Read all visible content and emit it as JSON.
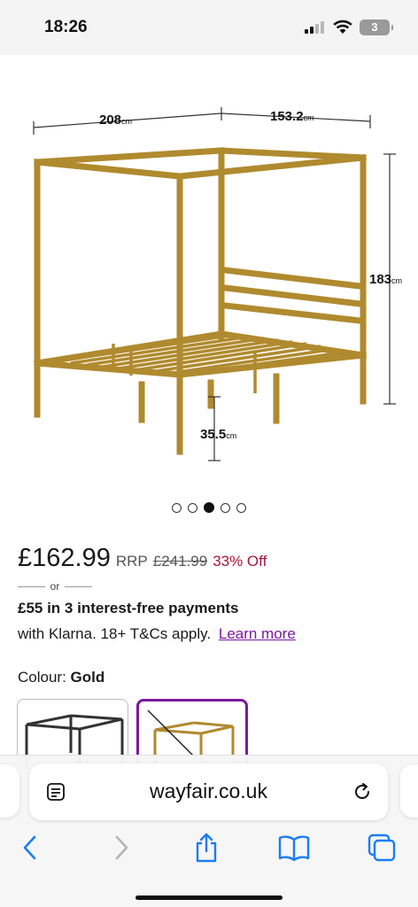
{
  "status_bar": {
    "time": "18:26",
    "battery_level": "3",
    "icons": [
      "signal-icon",
      "wifi-icon",
      "battery-icon"
    ]
  },
  "product_image": {
    "dimensions": {
      "width": "208",
      "depth": "153.2",
      "height": "183",
      "clearance": "35.5",
      "unit": "cm"
    },
    "frame_color": "#b08a2e"
  },
  "carousel": {
    "total": 5,
    "active_index": 2
  },
  "pricing": {
    "price": "£162.99",
    "rrp_label": "RRP",
    "old_price": "£241.99",
    "discount": "33% Off",
    "discount_color": "#a3153a"
  },
  "klarna": {
    "or_text": "or",
    "title": "£55 in 3 interest-free payments",
    "text": "with Klarna. 18+ T&Cs apply.",
    "link": "Learn more",
    "link_color": "#7b189f"
  },
  "colour": {
    "label": "Colour:",
    "selected": "Gold",
    "swatches": [
      {
        "name": "Black",
        "color": "#333333",
        "selected": false
      },
      {
        "name": "Gold",
        "color": "#b08a2e",
        "selected": true,
        "crossed_out": true
      }
    ]
  },
  "browser": {
    "url": "wayfair.co.uk",
    "icons": [
      "reader-icon",
      "reload-icon",
      "back-icon",
      "forward-icon",
      "share-icon",
      "bookmarks-icon",
      "tabs-icon"
    ],
    "accent": "#1a7cf5"
  }
}
